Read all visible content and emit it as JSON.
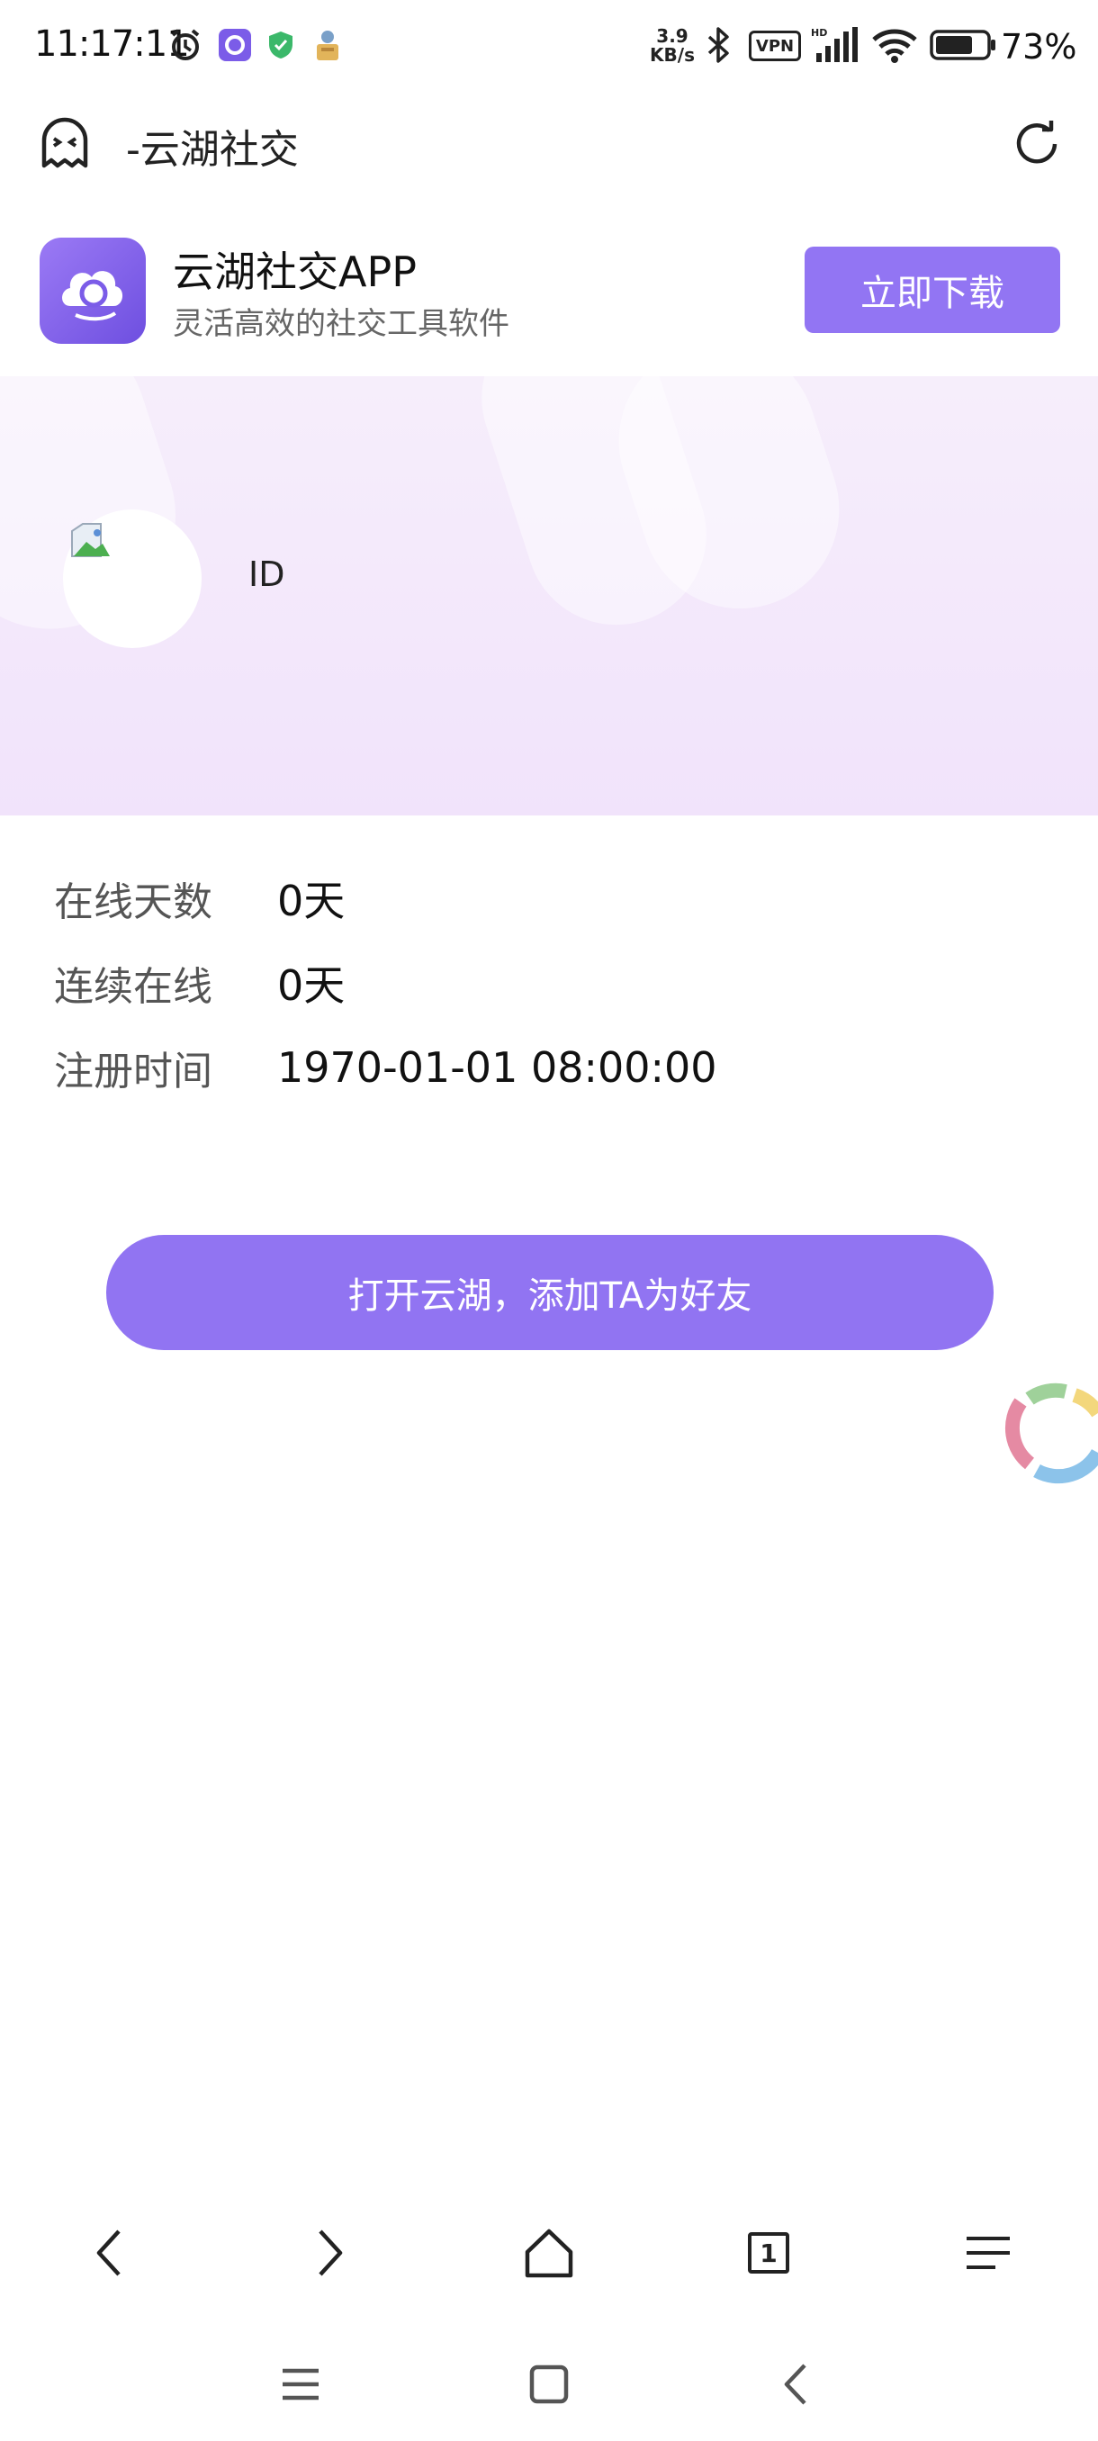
{
  "status_bar": {
    "time": "11:17:11",
    "net_speed_value": "3.9",
    "net_speed_unit": "KB/s",
    "vpn_label": "VPN",
    "hd_label": "HD",
    "battery_percent": "73%",
    "icons": [
      "alarm-icon",
      "yunhu-app-icon",
      "shield-icon",
      "notification-app-icon",
      "bluetooth-icon",
      "signal-icon",
      "wifi-icon",
      "battery-icon"
    ]
  },
  "browser_bar": {
    "title": "-云湖社交",
    "icons": [
      "ghost-icon",
      "refresh-icon"
    ]
  },
  "app_banner": {
    "name": "云湖社交APP",
    "description": "灵活高效的社交工具软件",
    "download_label": "立即下载",
    "accent_color": "#9275f3"
  },
  "profile": {
    "id_label": "ID"
  },
  "stats": [
    {
      "label": "在线天数",
      "value": "0天"
    },
    {
      "label": "连续在线",
      "value": "0天"
    },
    {
      "label": "注册时间",
      "value": "1970-01-01 08:00:00"
    }
  ],
  "action": {
    "add_friend_label": "打开云湖，添加TA为好友",
    "button_color": "#9174f2"
  },
  "browser_nav": {
    "tab_count": "1",
    "icons": [
      "back-icon",
      "forward-icon",
      "home-icon",
      "tabs-icon",
      "menu-icon"
    ]
  },
  "system_nav": {
    "icons": [
      "recent-apps-icon",
      "home-square-icon",
      "system-back-icon"
    ]
  }
}
